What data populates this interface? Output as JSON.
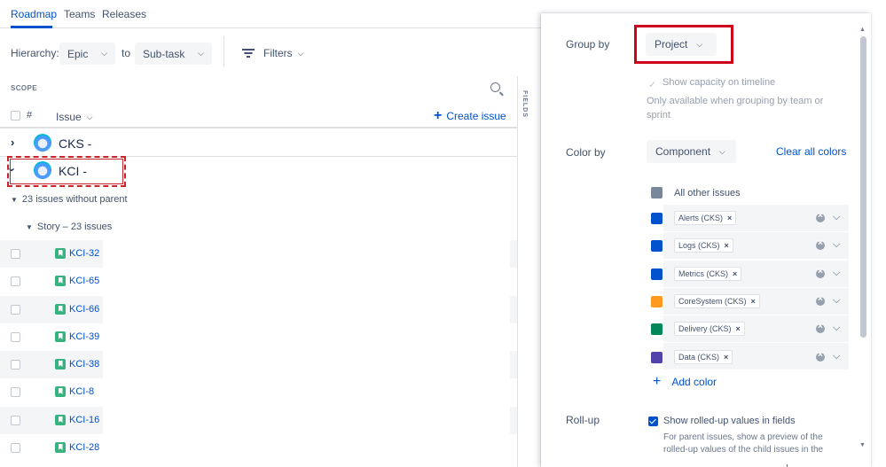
{
  "tabs": [
    "Roadmap",
    "Teams",
    "Releases"
  ],
  "hierarchy": {
    "label": "Hierarchy:",
    "from": "Epic",
    "to_label": "to",
    "to": "Sub-task"
  },
  "filters_label": "Filters",
  "scope_label": "SCOPE",
  "fields_label": "FIELDS",
  "columns": {
    "hash": "#",
    "issue": "Issue"
  },
  "create_issue": "Create issue",
  "projects": [
    {
      "name": "CKS -",
      "expanded": false
    },
    {
      "name": "KCI -",
      "expanded": true
    }
  ],
  "without_parent": "23 issues without parent",
  "story_group": "Story – 23 issues",
  "issues": [
    "KCI-32",
    "KCI-65",
    "KCI-66",
    "KCI-39",
    "KCI-38",
    "KCI-8",
    "KCI-16",
    "KCI-28"
  ],
  "panel": {
    "group_by_label": "Group by",
    "group_by_value": "Project",
    "show_capacity": "Show capacity on timeline",
    "capacity_note": "Only available when grouping by team or sprint",
    "color_by_label": "Color by",
    "color_by_value": "Component",
    "clear_all": "Clear all colors",
    "all_other": {
      "label": "All other issues",
      "color": "#7a869a"
    },
    "color_rows": [
      {
        "label": "Alerts (CKS)",
        "color": "#0052cc"
      },
      {
        "label": "Logs (CKS)",
        "color": "#0052cc"
      },
      {
        "label": "Metrics (CKS)",
        "color": "#0052cc"
      },
      {
        "label": "CoreSystem (CKS)",
        "color": "#ff991f"
      },
      {
        "label": "Delivery (CKS)",
        "color": "#00875a"
      },
      {
        "label": "Data (CKS)",
        "color": "#5243aa"
      }
    ],
    "add_color": "Add color",
    "rollup_label": "Roll-up",
    "rollup_check": "Show rolled-up values in fields",
    "rollup_note_1": "For parent issues, show a preview of the",
    "rollup_note_2": "rolled-up values of the child issues in the"
  }
}
